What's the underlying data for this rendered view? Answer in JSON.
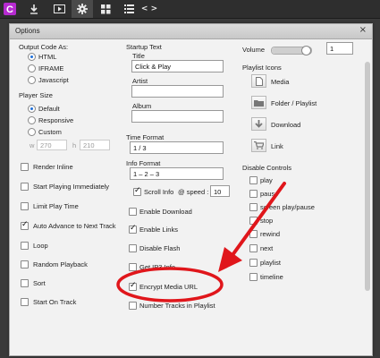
{
  "toolbar": {
    "logo": "C",
    "icons": [
      "download-icon",
      "media-icon",
      "gear-icon",
      "grid-icon",
      "list-icon",
      "code-icon"
    ],
    "code_label": "< >"
  },
  "dialog": {
    "title": "Options",
    "close": "×"
  },
  "output_code": {
    "heading": "Output Code As:",
    "options": [
      "HTML",
      "IFRAME",
      "Javascript"
    ],
    "selected": "HTML"
  },
  "player_size": {
    "heading": "Player Size",
    "options": [
      "Default",
      "Responsive",
      "Custom"
    ],
    "selected": "Default",
    "w_label": "w",
    "w_value": "270",
    "h_label": "h",
    "h_value": "210"
  },
  "left_checks": [
    {
      "label": "Render Inline",
      "checked": false
    },
    {
      "label": "Start Playing Immediately",
      "checked": false
    },
    {
      "label": "Limit Play Time",
      "checked": false
    },
    {
      "label": "Auto Advance to Next Track",
      "checked": true
    },
    {
      "label": "Loop",
      "checked": false
    },
    {
      "label": "Random Playback",
      "checked": false
    },
    {
      "label": "Sort",
      "checked": false
    },
    {
      "label": "Start On Track",
      "checked": false
    }
  ],
  "startup_text": {
    "heading": "Startup Text",
    "title_label": "Title",
    "title_value": "Click & Play",
    "artist_label": "Artist",
    "artist_value": "",
    "album_label": "Album",
    "album_value": ""
  },
  "time_format": {
    "label": "Time Format",
    "value": "1 / 3"
  },
  "info_format": {
    "label": "Info Format",
    "value": "1 – 2 – 3"
  },
  "scroll_info": {
    "label": "Scroll Info",
    "speed_label": "@ speed :",
    "speed_value": "10",
    "checked": true
  },
  "middle_checks": [
    {
      "label": "Enable Download",
      "checked": false
    },
    {
      "label": "Enable Links",
      "checked": true
    },
    {
      "label": "Disable Flash",
      "checked": false
    },
    {
      "label": "Get IP3 Info",
      "checked": false
    },
    {
      "label": "Encrypt Media URL",
      "checked": true
    },
    {
      "label": "Number Tracks in Playlist",
      "checked": false
    }
  ],
  "volume": {
    "label": "Volume",
    "value": "1",
    "level": 1.0
  },
  "playlist_icons": {
    "heading": "Playlist Icons",
    "items": [
      {
        "label": "Media",
        "icon": "file-icon"
      },
      {
        "label": "Folder / Playlist",
        "icon": "folder-icon"
      },
      {
        "label": "Download",
        "icon": "download-icon"
      },
      {
        "label": "Link",
        "icon": "cart-icon"
      }
    ]
  },
  "disable_controls": {
    "heading": "Disable Controls",
    "items": [
      "play",
      "pause",
      "screen play/pause",
      "stop",
      "rewind",
      "next",
      "playlist",
      "timeline"
    ]
  },
  "annotation_color": "#e0161b"
}
